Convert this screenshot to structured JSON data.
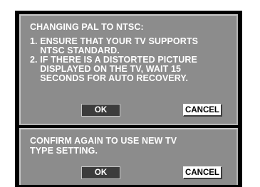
{
  "dialog1": {
    "title": "CHANGING PAL TO NTSC:",
    "lines": [
      "1. ENSURE THAT YOUR TV SUPPORTS",
      "    NTSC STANDARD.",
      "2. IF THERE IS A DISTORTED PICTURE",
      "    DISPLAYED ON THE TV, WAIT 15",
      "    SECONDS FOR AUTO RECOVERY."
    ],
    "ok_label": "OK",
    "cancel_label": "CANCEL"
  },
  "dialog2": {
    "lines": [
      "CONFIRM AGAIN TO USE NEW TV",
      "TYPE SETTING."
    ],
    "ok_label": "OK",
    "cancel_label": "CANCEL"
  },
  "colors": {
    "panel": "#8c8c8c",
    "screen": "#000000",
    "ok_button": "#3c3c3c",
    "cancel_button": "#ffffff"
  }
}
